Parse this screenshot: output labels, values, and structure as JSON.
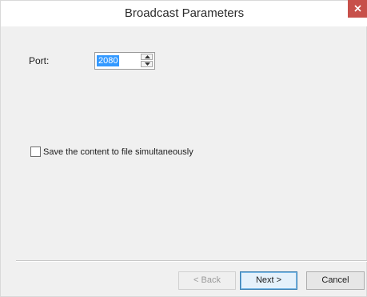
{
  "window": {
    "title": "Broadcast Parameters",
    "close_icon": "close-icon",
    "close_color": "#c7504a"
  },
  "form": {
    "port_label": "Port:",
    "port_value": "2080",
    "port_selected": true,
    "selection_color": "#3399ff",
    "save_checkbox_label": "Save the content to file simultaneously",
    "save_checkbox_checked": false
  },
  "buttons": {
    "back": "< Back",
    "back_enabled": false,
    "next": "Next >",
    "cancel": "Cancel"
  }
}
